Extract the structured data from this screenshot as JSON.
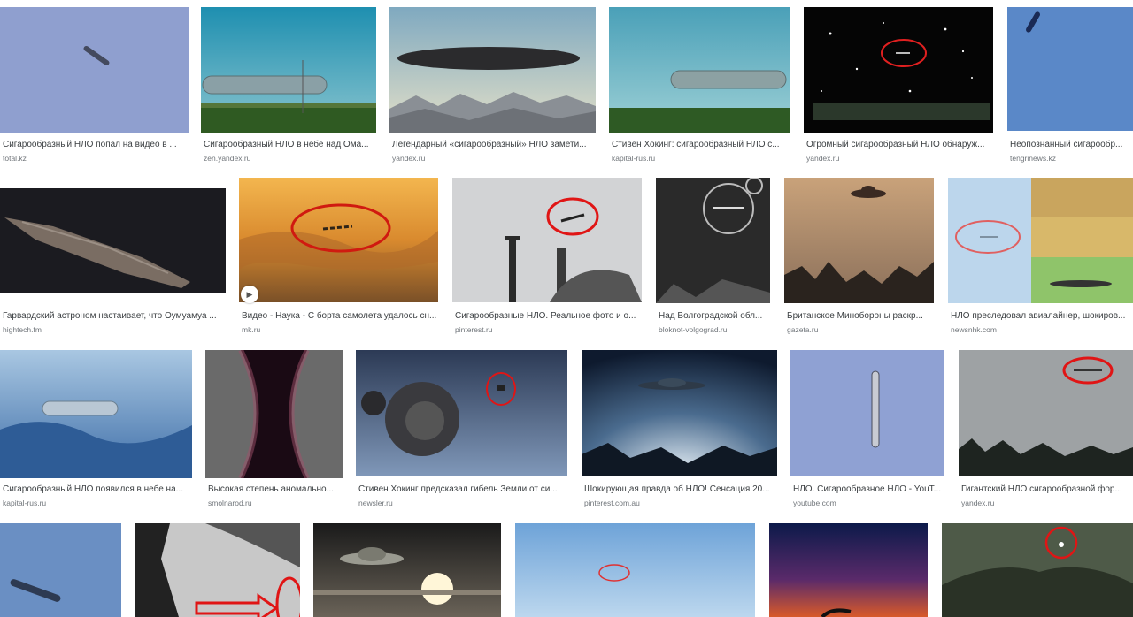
{
  "results": [
    {
      "title": "Сигарообразный НЛО попал на видео в ...",
      "source": "total.kz"
    },
    {
      "title": "Сигарообразный НЛО в небе над Ома...",
      "source": "zen.yandex.ru"
    },
    {
      "title": "Легендарный «сигарообразный» НЛО замети...",
      "source": "yandex.ru"
    },
    {
      "title": "Стивен Хокинг: сигарообразный НЛО с...",
      "source": "kapital-rus.ru"
    },
    {
      "title": "Огромный сигарообразный НЛО обнаруж...",
      "source": "yandex.ru"
    },
    {
      "title": "Неопознанный сигарообр...",
      "source": "tengrinews.kz"
    },
    {
      "title": "Гарвардский астроном настаивает, что Оумуамуа ...",
      "source": "hightech.fm"
    },
    {
      "title": "Видео - Наука - С борта самолета удалось сн...",
      "source": "mk.ru"
    },
    {
      "title": "Сигарообразные НЛО. Реальное фото и о...",
      "source": "pinterest.ru"
    },
    {
      "title": "Над Волгоградской обл...",
      "source": "bloknot-volgograd.ru"
    },
    {
      "title": "Британское Минобороны раскр...",
      "source": "gazeta.ru"
    },
    {
      "title": "НЛО преследовал авиалайнер, шокиров...",
      "source": "newsnhk.com"
    },
    {
      "title": "Сигарообразный НЛО появился в небе на...",
      "source": "kapital-rus.ru"
    },
    {
      "title": "Высокая степень аномально...",
      "source": "smolnarod.ru"
    },
    {
      "title": "Стивен Хокинг предсказал гибель Земли от си...",
      "source": "newsler.ru"
    },
    {
      "title": "Шокирующая правда об НЛО! Сенсация 20...",
      "source": "pinterest.com.au"
    },
    {
      "title": "НЛО. Сигарообразное НЛО - YouT...",
      "source": "youtube.com"
    },
    {
      "title": "Гигантский НЛО сигарообразной фор...",
      "source": "yandex.ru"
    }
  ],
  "video_badge_icon": "play-icon"
}
